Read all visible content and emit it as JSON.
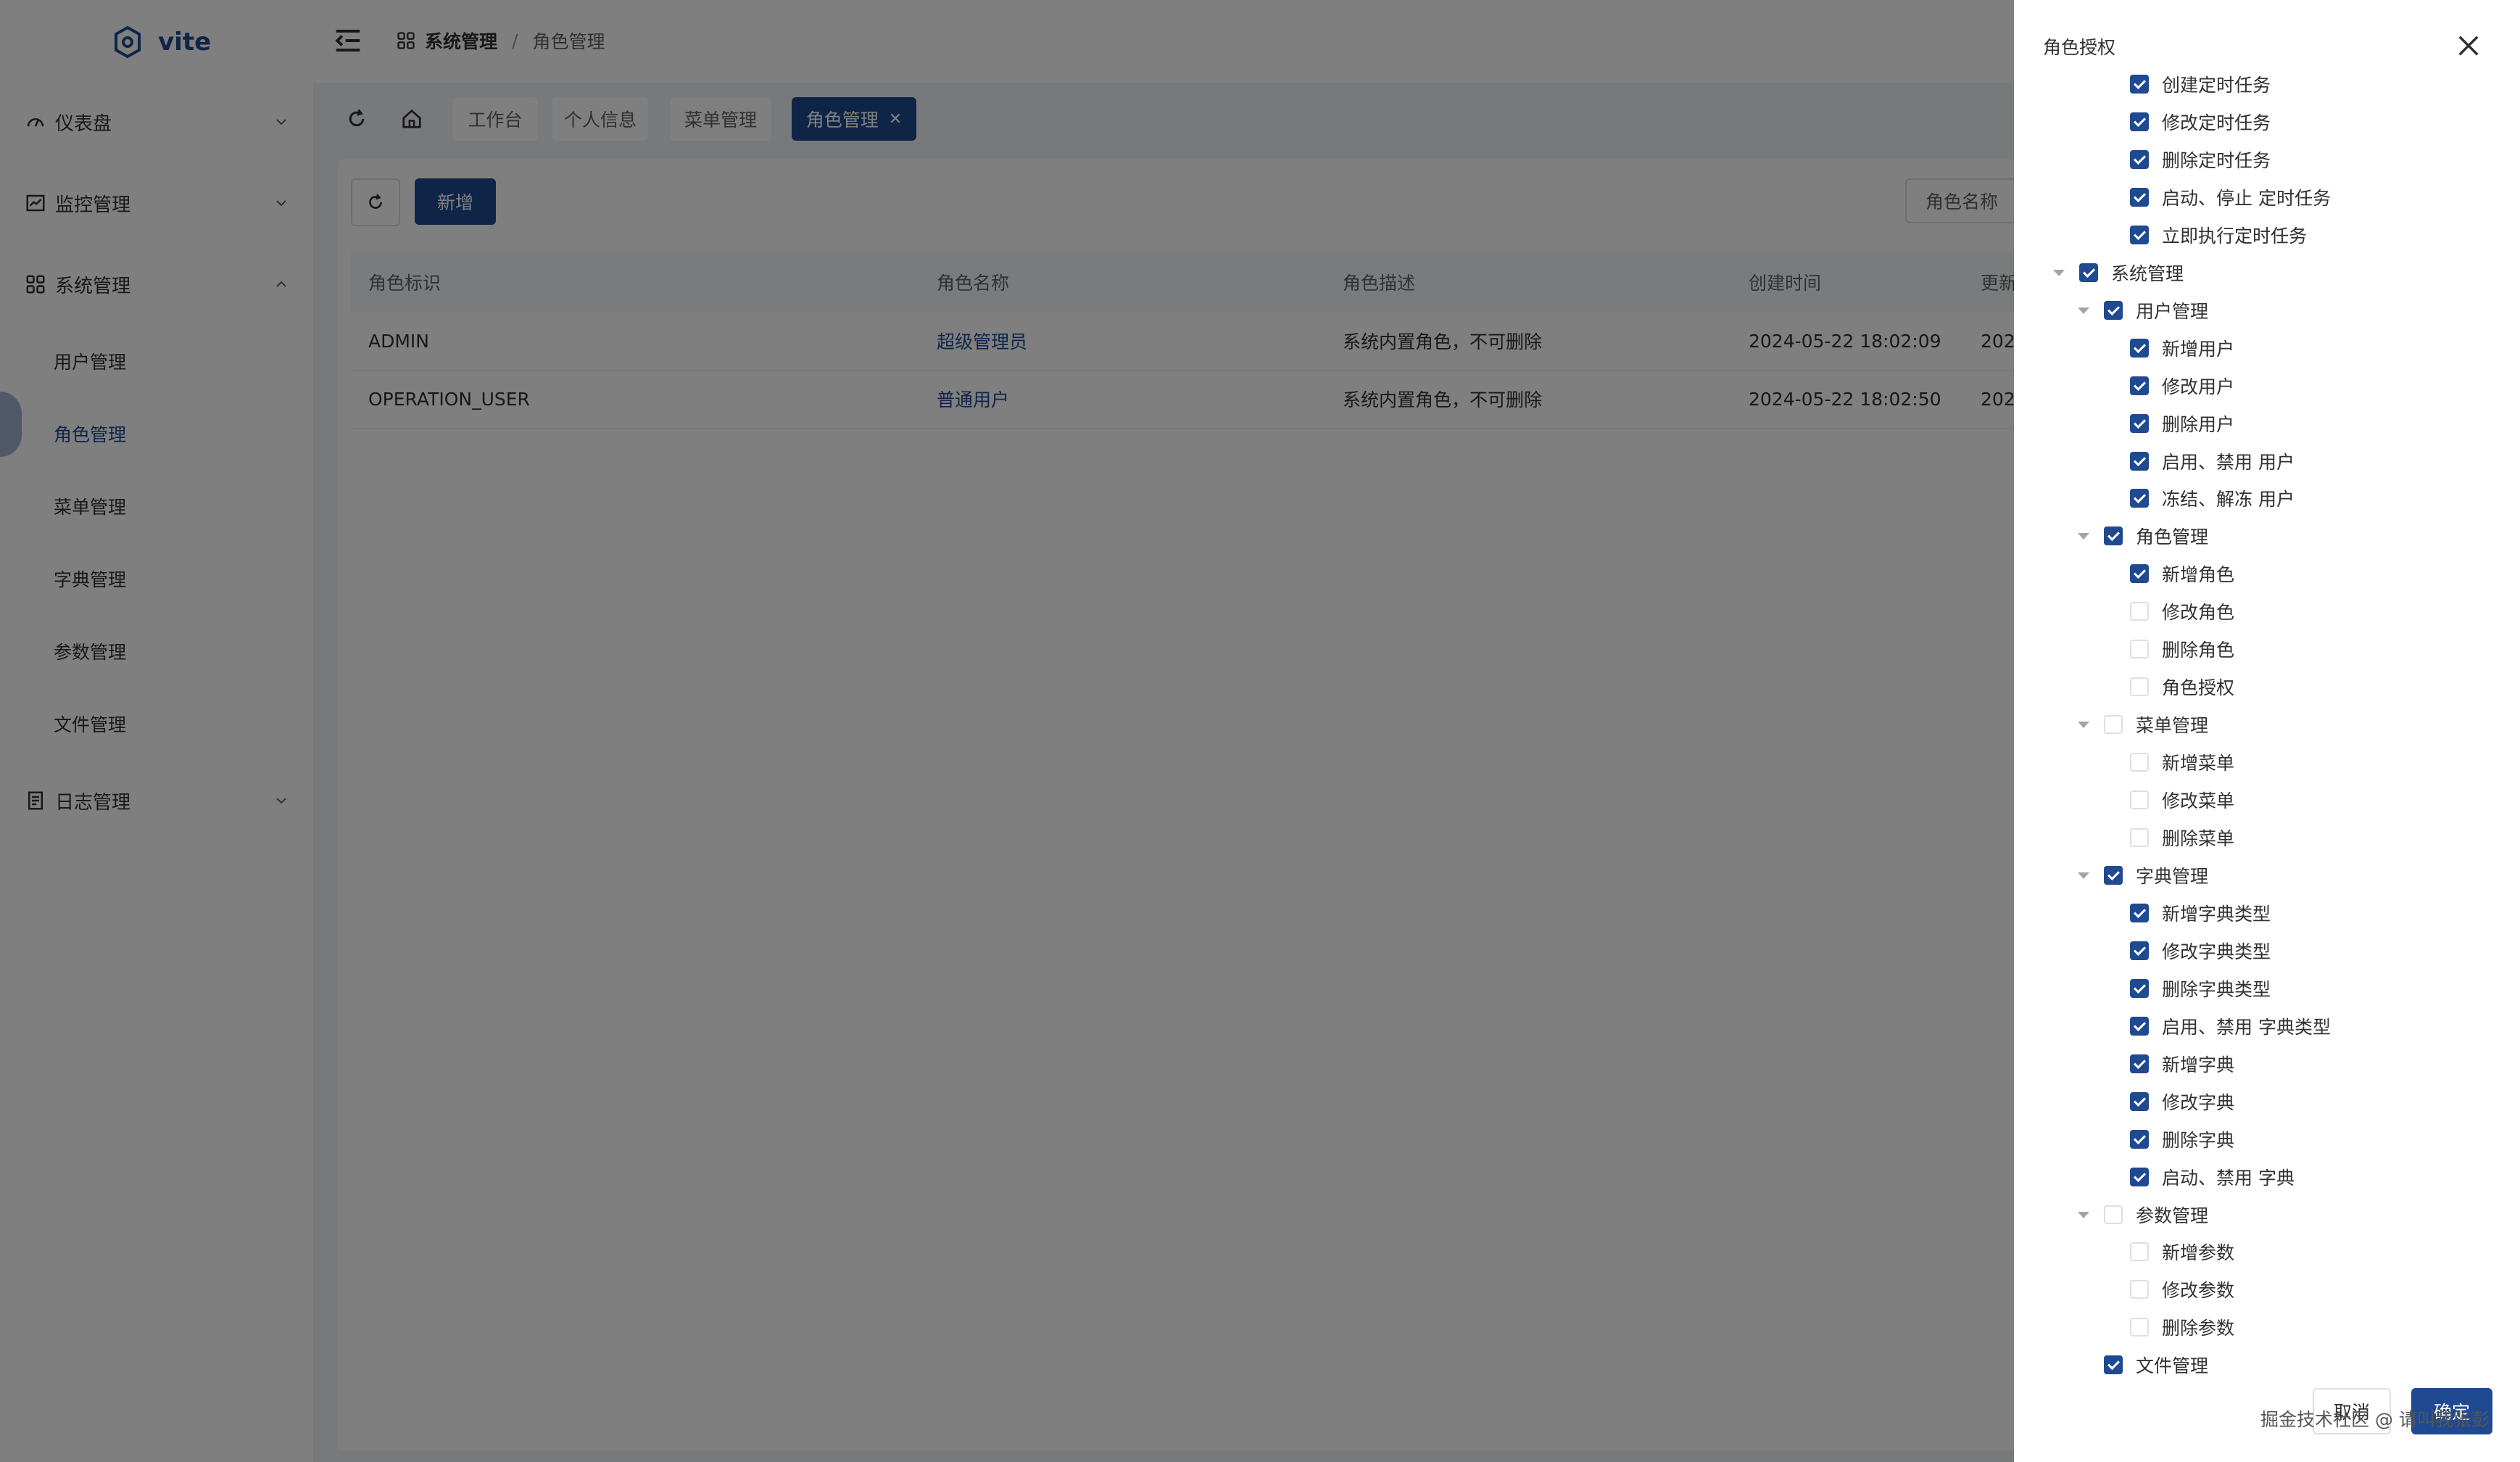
{
  "app": {
    "logo_text": "vite"
  },
  "sidebar": {
    "groups": [
      {
        "label": "仪表盘",
        "icon": "dashboard-icon"
      },
      {
        "label": "监控管理",
        "icon": "monitor-icon"
      },
      {
        "label": "系统管理",
        "icon": "grid-icon"
      },
      {
        "label": "日志管理",
        "icon": "log-icon"
      }
    ],
    "system_items": [
      "用户管理",
      "角色管理",
      "菜单管理",
      "字典管理",
      "参数管理",
      "文件管理"
    ]
  },
  "header": {
    "breadcrumb": [
      "系统管理",
      "角色管理"
    ],
    "separator": "/"
  },
  "tabs": [
    "工作台",
    "个人信息",
    "菜单管理",
    "角色管理"
  ],
  "toolbar": {
    "add_label": "新增",
    "filter_placeholder": "角色名称"
  },
  "table": {
    "columns": [
      "角色标识",
      "角色名称",
      "角色描述",
      "创建时间",
      "更新"
    ],
    "rows": [
      [
        "ADMIN",
        "超级管理员",
        "系统内置角色，不可删除",
        "2024-05-22 18:02:09",
        "202"
      ],
      [
        "OPERATION_USER",
        "普通用户",
        "系统内置角色，不可删除",
        "2024-05-22 18:02:50",
        "202"
      ]
    ]
  },
  "drawer": {
    "title": "角色授权",
    "nodes": [
      {
        "label": "创建定时任务",
        "checked": true
      },
      {
        "label": "修改定时任务",
        "checked": true
      },
      {
        "label": "删除定时任务",
        "checked": true
      },
      {
        "label": "启动、停止 定时任务",
        "checked": true
      },
      {
        "label": "立即执行定时任务",
        "checked": true
      },
      {
        "label": "系统管理",
        "checked": true
      },
      {
        "label": "用户管理",
        "checked": true
      },
      {
        "label": "新增用户",
        "checked": true
      },
      {
        "label": "修改用户",
        "checked": true
      },
      {
        "label": "删除用户",
        "checked": true
      },
      {
        "label": "启用、禁用 用户",
        "checked": true
      },
      {
        "label": "冻结、解冻 用户",
        "checked": true
      },
      {
        "label": "角色管理",
        "checked": true
      },
      {
        "label": "新增角色",
        "checked": true
      },
      {
        "label": "修改角色",
        "checked": false
      },
      {
        "label": "删除角色",
        "checked": false
      },
      {
        "label": "角色授权",
        "checked": false
      },
      {
        "label": "菜单管理",
        "checked": false
      },
      {
        "label": "新增菜单",
        "checked": false
      },
      {
        "label": "修改菜单",
        "checked": false
      },
      {
        "label": "删除菜单",
        "checked": false
      },
      {
        "label": "字典管理",
        "checked": true
      },
      {
        "label": "新增字典类型",
        "checked": true
      },
      {
        "label": "修改字典类型",
        "checked": true
      },
      {
        "label": "删除字典类型",
        "checked": true
      },
      {
        "label": "启用、禁用 字典类型",
        "checked": true
      },
      {
        "label": "新增字典",
        "checked": true
      },
      {
        "label": "修改字典",
        "checked": true
      },
      {
        "label": "删除字典",
        "checked": true
      },
      {
        "label": "启动、禁用 字典",
        "checked": true
      },
      {
        "label": "参数管理",
        "checked": false
      },
      {
        "label": "新增参数",
        "checked": false
      },
      {
        "label": "修改参数",
        "checked": false
      },
      {
        "label": "删除参数",
        "checked": false
      },
      {
        "label": "文件管理",
        "checked": true
      }
    ],
    "cancel_label": "取消",
    "ok_label": "确定"
  },
  "watermark": "掘金技术社区 @ 请叫我张彭",
  "colors": {
    "primary": "#1f4a91",
    "mask": "rgba(0,0,0,0.5)",
    "background": "#f0f2f5"
  }
}
